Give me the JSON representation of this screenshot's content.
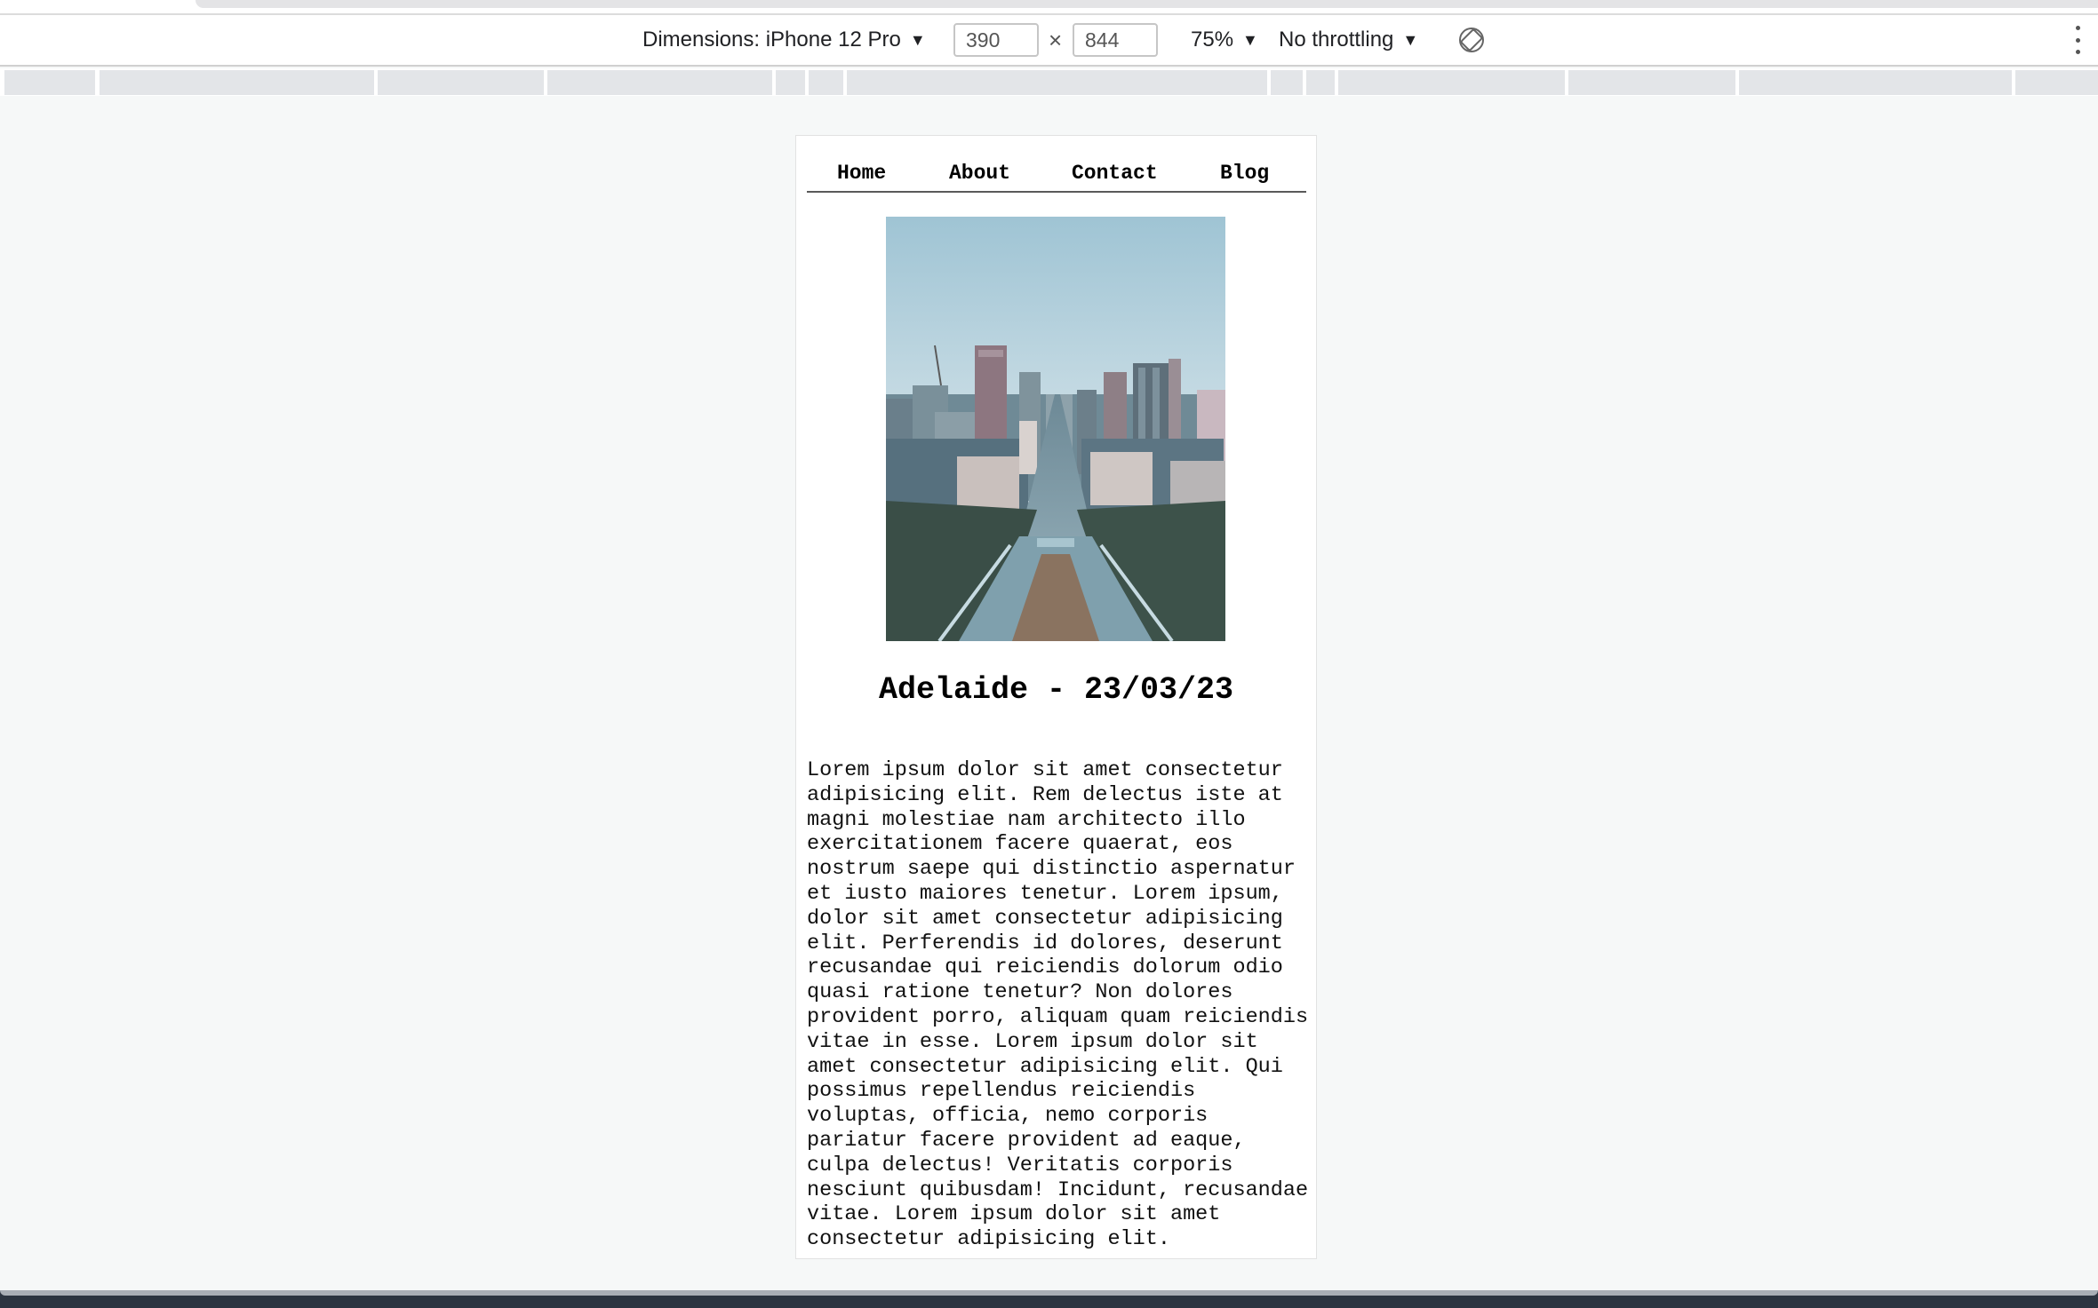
{
  "toolbar": {
    "dimensions_label": "Dimensions: iPhone 12 Pro",
    "width_value": "390",
    "height_value": "844",
    "times_symbol": "×",
    "zoom_label": "75%",
    "throttling_label": "No throttling",
    "caret": "▼",
    "icons": [
      "rotate-icon",
      "more-vert-icon"
    ]
  },
  "nav": {
    "items": [
      {
        "label": "Home"
      },
      {
        "label": "About"
      },
      {
        "label": "Contact"
      },
      {
        "label": "Blog"
      }
    ]
  },
  "post": {
    "title": "Adelaide - 23/03/23",
    "body": "Lorem ipsum dolor sit amet consectetur adipisicing elit. Rem delectus iste at magni molestiae nam architecto illo exercitationem facere quaerat, eos nostrum saepe qui distinctio aspernatur et iusto maiores tenetur. Lorem ipsum, dolor sit amet consectetur adipisicing elit. Perferendis id dolores, deserunt recusandae qui reiciendis dolorum odio quasi ratione tenetur? Non dolores provident porro, aliquam quam reiciendis vitae in esse. Lorem ipsum dolor sit amet consectetur adipisicing elit. Qui possimus repellendus reiciendis voluptas, officia, nemo corporis pariatur facere provident ad eaque, culpa delectus! Veritatis corporis nesciunt quibusdam! Incidunt, recusandae vitae. Lorem ipsum dolor sit amet consectetur adipisicing elit."
  },
  "colors": {
    "page_background": "#f6f8f8",
    "nav_underline": "#5a5a5a",
    "sky": "#c9dde6"
  }
}
